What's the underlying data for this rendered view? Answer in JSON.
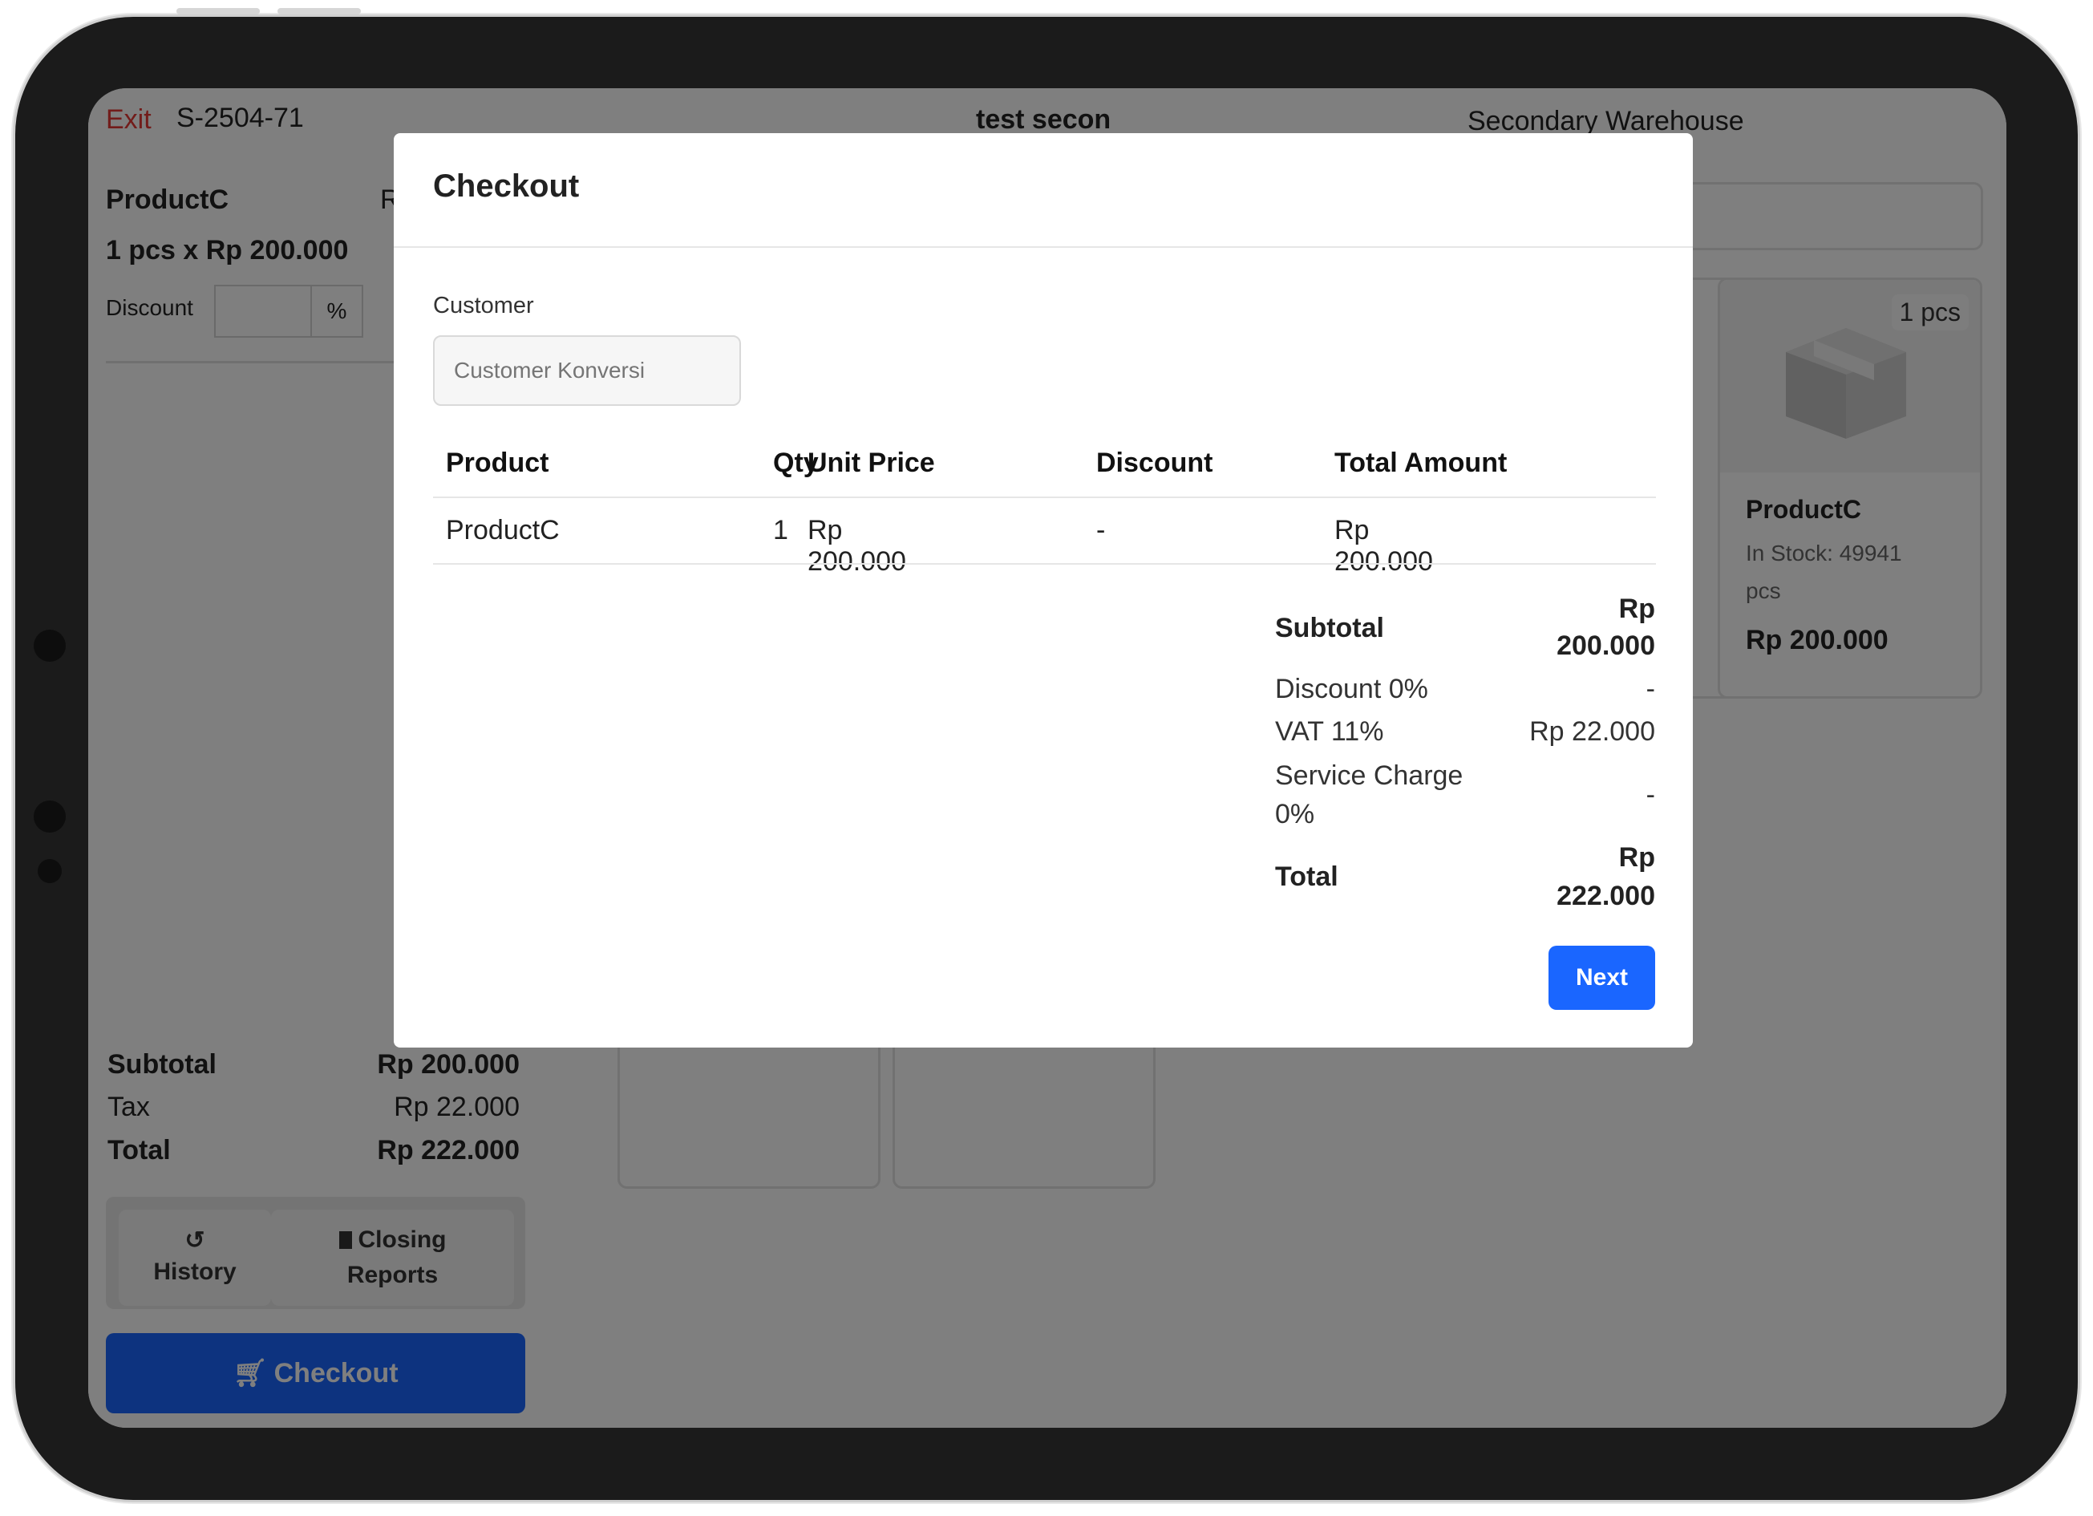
{
  "topbar": {
    "exit": "Exit",
    "order_id": "S-2504-71",
    "user": "test secon",
    "warehouse": "Secondary Warehouse"
  },
  "cart": {
    "item_name": "ProductC",
    "item_price_partial": "R",
    "item_qty_price": "1 pcs x Rp 200.000",
    "discount_label": "Discount",
    "discount_value": "",
    "discount_unit": "%"
  },
  "product_card": {
    "qty_badge": "1 pcs",
    "name": "ProductC",
    "stock": "In Stock: 49941",
    "stock_unit": "pcs",
    "price": "Rp 200.000",
    "icon": "box-icon"
  },
  "totals": {
    "subtotal_label": "Subtotal",
    "subtotal_value": "Rp 200.000",
    "tax_label": "Tax",
    "tax_value": "Rp 22.000",
    "total_label": "Total",
    "total_value": "Rp 222.000"
  },
  "actions": {
    "history": "History",
    "history_icon": "history-icon",
    "closing_line1": "Closing",
    "closing_line2": "Reports",
    "closing_icon": "file-icon",
    "checkout": "Checkout",
    "checkout_icon": "cart-icon"
  },
  "modal": {
    "title": "Checkout",
    "customer_label": "Customer",
    "customer_placeholder": "Customer Konversi",
    "columns": [
      "Product",
      "Qty",
      "Unit Price",
      "Discount",
      "Total Amount"
    ],
    "rows": [
      {
        "product": "ProductC",
        "qty": "1",
        "unit_price": "Rp 200.000",
        "discount": "-",
        "total": "Rp 200.000"
      }
    ],
    "summary": {
      "subtotal_label": "Subtotal",
      "subtotal_value_1": "Rp",
      "subtotal_value_2": "200.000",
      "discount_label": "Discount 0%",
      "discount_value": "-",
      "vat_label": "VAT 11%",
      "vat_value": "Rp 22.000",
      "service_label_1": "Service Charge",
      "service_label_2": "0%",
      "service_value": "-",
      "total_label": "Total",
      "total_value_1": "Rp",
      "total_value_2": "222.000"
    },
    "next_button": "Next"
  },
  "colors": {
    "accent": "#1a66ff",
    "exit": "#e53935",
    "overlay": "rgba(0,0,0,0.5)"
  }
}
